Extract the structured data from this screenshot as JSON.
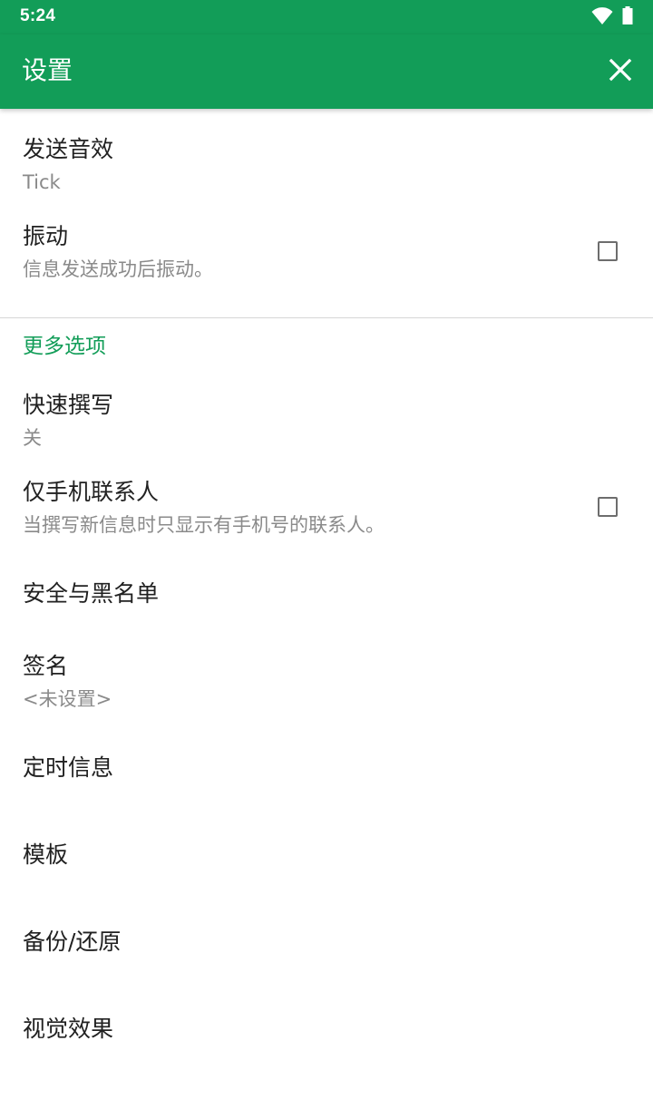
{
  "status_bar": {
    "time": "5:24"
  },
  "app_bar": {
    "title": "设置",
    "close_icon": "close-icon"
  },
  "settings": {
    "send_sound": {
      "title": "发送音效",
      "summary": "Tick"
    },
    "vibrate": {
      "title": "振动",
      "summary": "信息发送成功后振动。",
      "checked": false
    }
  },
  "more_options": {
    "header": "更多选项",
    "quick_compose": {
      "title": "快速撰写",
      "summary": "关"
    },
    "mobile_only": {
      "title": "仅手机联系人",
      "summary": "当撰写新信息时只显示有手机号的联系人。",
      "checked": false
    },
    "security_blacklist": {
      "title": "安全与黑名单"
    },
    "signature": {
      "title": "签名",
      "summary": "<未设置>"
    },
    "scheduled": {
      "title": "定时信息"
    },
    "templates": {
      "title": "模板"
    },
    "backup_restore": {
      "title": "备份/还原"
    },
    "visual_effects": {
      "title": "视觉效果"
    }
  },
  "colors": {
    "accent": "#129d58",
    "primary_text": "#212121",
    "secondary_text": "#8a8a8a"
  }
}
